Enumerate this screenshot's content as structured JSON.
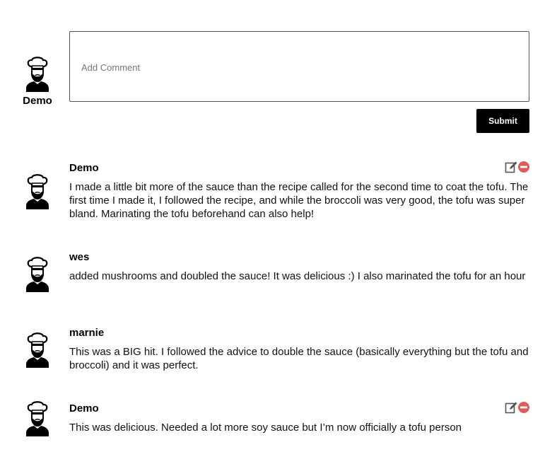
{
  "composer": {
    "user_name": "Demo",
    "placeholder": "Add Comment",
    "submit_label": "Submit"
  },
  "comments": [
    {
      "author": "Demo",
      "text": "I made a little bit more of the sauce than the recipe called for the second time to coat the tofu. The first time I made it, I followed the recipe, and while the broccoli was very good, the tofu was super bland. Marinating the tofu beforehand can also help!",
      "editable": true
    },
    {
      "author": "wes",
      "text": "added mushrooms and doubled the sauce! It was delicious :) I also marinated the tofu for an hour",
      "editable": false
    },
    {
      "author": "marnie",
      "text": "This was a BIG hit. I followed the advice to double the sauce (basically everything but the tofu and broccoli) and it was perfect.",
      "editable": false
    },
    {
      "author": "Demo",
      "text": "This was delicious. Needed a lot more soy sauce but I’m now officially a tofu person",
      "editable": true
    }
  ],
  "icons": {
    "avatar": "chef-avatar-icon",
    "edit": "edit-icon",
    "delete": "delete-icon"
  },
  "colors": {
    "submit_bg": "#000000",
    "delete_icon": "#e05a5a",
    "edit_icon": "#555555"
  }
}
